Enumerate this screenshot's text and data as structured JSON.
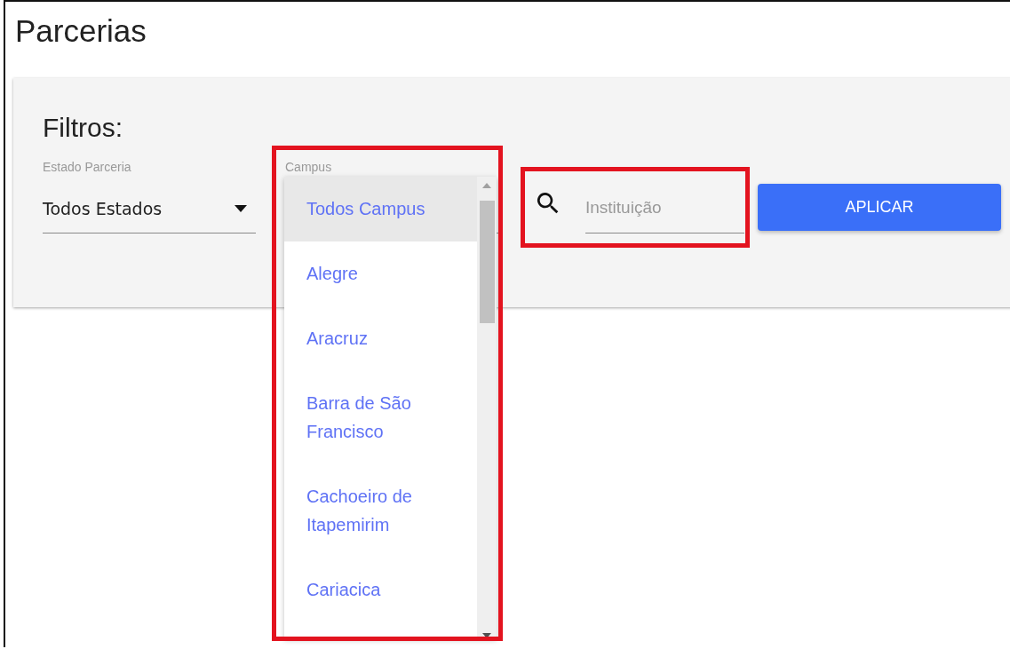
{
  "page": {
    "title": "Parcerias"
  },
  "filters": {
    "heading": "Filtros:",
    "estado": {
      "label": "Estado Parceria",
      "value": "Todos Estados"
    },
    "campus": {
      "label": "Campus",
      "highlighted": true,
      "expanded": true,
      "options": [
        {
          "label": "Todos Campus",
          "selected": true
        },
        {
          "label": "Alegre",
          "selected": false
        },
        {
          "label": "Aracruz",
          "selected": false
        },
        {
          "label": "Barra de São Francisco",
          "selected": false
        },
        {
          "label": "Cachoeiro de Itapemirim",
          "selected": false
        },
        {
          "label": "Cariacica",
          "selected": false
        }
      ]
    },
    "search": {
      "placeholder": "Instituição",
      "highlighted": true
    },
    "apply_button": "APLICAR"
  }
}
